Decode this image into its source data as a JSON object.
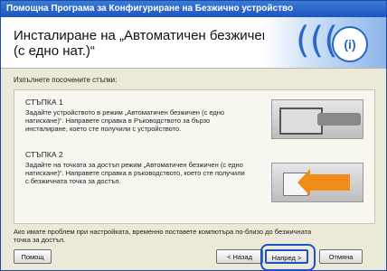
{
  "window": {
    "title": "Помощна Програма за Конфигуриране на Безжично устройство"
  },
  "header": {
    "title": "Инсталиране на „Автоматичен безжичен (с едно нат.)“",
    "logo_text": "(i)"
  },
  "instruction": "Изпълнете посочените стъпки:",
  "steps": [
    {
      "title": "СТЪПКА 1",
      "text": "Задайте устройството в режим „Автоматичен безжичен (с едно натискане)“. Направете справка в Ръководството за бързо инсталиране, което сте получили с устройството."
    },
    {
      "title": "СТЪПКА 2",
      "text": "Задайте на точката за достъп режим „Автоматичен безжичен (с едно натискане)“. Направете справка в ръководството, което сте получили с безжичната точка за достъп."
    }
  ],
  "note": "Ако имате проблем при настройката, временно поставете компютъра по-близо до безжичната точка за достъп.",
  "buttons": {
    "help": "Помощ",
    "back": "< Назад",
    "next": "Напред >",
    "cancel": "Отмяна"
  },
  "colors": {
    "titlebar": "#1c55c2",
    "focus": "#1a53c8",
    "arrow": "#1762c8",
    "step_arrow": "#f28c18"
  }
}
